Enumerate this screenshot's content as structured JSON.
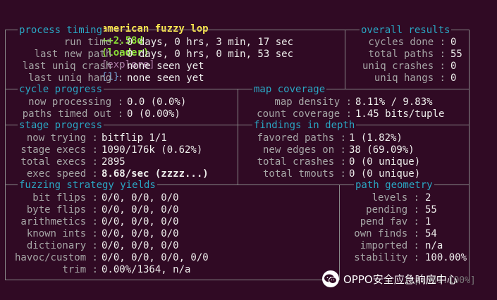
{
  "header": {
    "title": "american fuzzy lop",
    "version": "++2.58d",
    "target": "(loader)",
    "mode": "[explore]",
    "instance": "{1}"
  },
  "process_timing": {
    "title": "process timing",
    "run_time_label": "run time :",
    "run_time": "0 days, 0 hrs, 3 min, 17 sec",
    "last_new_path_label": "last new path :",
    "last_new_path": "0 days, 0 hrs, 0 min, 53 sec",
    "last_uniq_crash_label": "last uniq crash :",
    "last_uniq_crash": "none seen yet",
    "last_uniq_hang_label": "last uniq hang :",
    "last_uniq_hang": "none seen yet"
  },
  "overall_results": {
    "title": "overall results",
    "cycles_done_label": "cycles done :",
    "cycles_done": "0",
    "total_paths_label": "total paths :",
    "total_paths": "55",
    "uniq_crashes_label": "uniq crashes :",
    "uniq_crashes": "0",
    "uniq_hangs_label": "uniq hangs :",
    "uniq_hangs": "0"
  },
  "cycle_progress": {
    "title": "cycle progress",
    "now_processing_label": "now processing :",
    "now_processing": "0.0 (0.0%)",
    "paths_timed_out_label": "paths timed out :",
    "paths_timed_out": "0 (0.00%)"
  },
  "map_coverage": {
    "title": "map coverage",
    "map_density_label": "map density :",
    "map_density": "8.11% / 9.83%",
    "count_coverage_label": "count coverage :",
    "count_coverage": "1.45 bits/tuple"
  },
  "stage_progress": {
    "title": "stage progress",
    "now_trying_label": "now trying :",
    "now_trying": "bitflip 1/1",
    "stage_execs_label": "stage execs :",
    "stage_execs": "1090/176k (0.62%)",
    "total_execs_label": "total execs :",
    "total_execs": "2895",
    "exec_speed_label": "exec speed :",
    "exec_speed": "8.68/sec (zzzz...)"
  },
  "findings": {
    "title": "findings in depth",
    "favored_paths_label": "favored paths :",
    "favored_paths": "1 (1.82%)",
    "new_edges_label": "new edges on :",
    "new_edges": "38 (69.09%)",
    "total_crashes_label": "total crashes :",
    "total_crashes": "0 (0 unique)",
    "total_tmouts_label": "total tmouts :",
    "total_tmouts": "0 (0 unique)"
  },
  "strategy": {
    "title": "fuzzing strategy yields",
    "rows": [
      {
        "label": "bit flips :",
        "value": "0/0, 0/0, 0/0"
      },
      {
        "label": "byte flips :",
        "value": "0/0, 0/0, 0/0"
      },
      {
        "label": "arithmetics :",
        "value": "0/0, 0/0, 0/0"
      },
      {
        "label": "known ints :",
        "value": "0/0, 0/0, 0/0"
      },
      {
        "label": "dictionary :",
        "value": "0/0, 0/0, 0/0"
      },
      {
        "label": "havoc/custom :",
        "value": "0/0, 0/0, 0/0, 0/0"
      },
      {
        "label": "trim :",
        "value": "0.00%/1364, n/a"
      }
    ]
  },
  "path_geometry": {
    "title": "path geometry",
    "rows": [
      {
        "label": "levels :",
        "value": "2"
      },
      {
        "label": "pending :",
        "value": "55"
      },
      {
        "label": "pend fav :",
        "value": "1"
      },
      {
        "label": "own finds :",
        "value": "54"
      },
      {
        "label": "imported :",
        "value": "n/a"
      },
      {
        "label": "stability :",
        "value": "100.00%"
      }
    ]
  },
  "footer": {
    "cpu": "[cpu001:100%]"
  },
  "watermark": {
    "text": "OPPO安全应急响应中心",
    "icon": "wechat-icon"
  },
  "colors": {
    "background": "#300a24",
    "section_title": "#2aa6c3",
    "label": "#a6a6a6",
    "value": "#eeeeec",
    "alert": "#ef2929",
    "title": "#fce94f",
    "version": "#8ae234"
  }
}
